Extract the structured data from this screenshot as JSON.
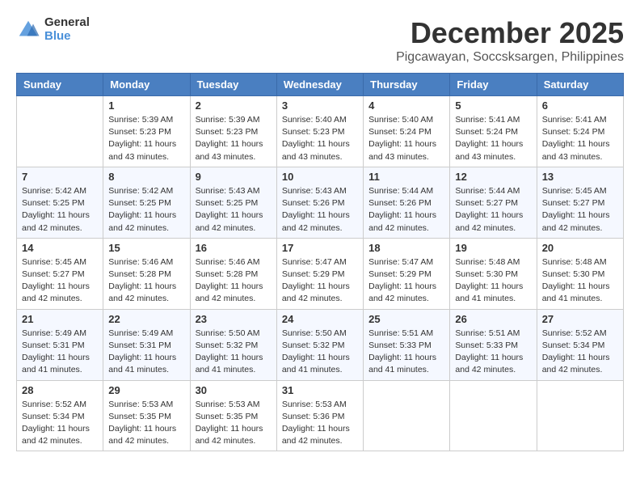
{
  "header": {
    "logo_line1": "General",
    "logo_line2": "Blue",
    "month": "December 2025",
    "location": "Pigcawayan, Soccsksargen, Philippines"
  },
  "weekdays": [
    "Sunday",
    "Monday",
    "Tuesday",
    "Wednesday",
    "Thursday",
    "Friday",
    "Saturday"
  ],
  "weeks": [
    [
      {
        "day": "",
        "info": ""
      },
      {
        "day": "1",
        "info": "Sunrise: 5:39 AM\nSunset: 5:23 PM\nDaylight: 11 hours\nand 43 minutes."
      },
      {
        "day": "2",
        "info": "Sunrise: 5:39 AM\nSunset: 5:23 PM\nDaylight: 11 hours\nand 43 minutes."
      },
      {
        "day": "3",
        "info": "Sunrise: 5:40 AM\nSunset: 5:23 PM\nDaylight: 11 hours\nand 43 minutes."
      },
      {
        "day": "4",
        "info": "Sunrise: 5:40 AM\nSunset: 5:24 PM\nDaylight: 11 hours\nand 43 minutes."
      },
      {
        "day": "5",
        "info": "Sunrise: 5:41 AM\nSunset: 5:24 PM\nDaylight: 11 hours\nand 43 minutes."
      },
      {
        "day": "6",
        "info": "Sunrise: 5:41 AM\nSunset: 5:24 PM\nDaylight: 11 hours\nand 43 minutes."
      }
    ],
    [
      {
        "day": "7",
        "info": "Sunrise: 5:42 AM\nSunset: 5:25 PM\nDaylight: 11 hours\nand 42 minutes."
      },
      {
        "day": "8",
        "info": "Sunrise: 5:42 AM\nSunset: 5:25 PM\nDaylight: 11 hours\nand 42 minutes."
      },
      {
        "day": "9",
        "info": "Sunrise: 5:43 AM\nSunset: 5:25 PM\nDaylight: 11 hours\nand 42 minutes."
      },
      {
        "day": "10",
        "info": "Sunrise: 5:43 AM\nSunset: 5:26 PM\nDaylight: 11 hours\nand 42 minutes."
      },
      {
        "day": "11",
        "info": "Sunrise: 5:44 AM\nSunset: 5:26 PM\nDaylight: 11 hours\nand 42 minutes."
      },
      {
        "day": "12",
        "info": "Sunrise: 5:44 AM\nSunset: 5:27 PM\nDaylight: 11 hours\nand 42 minutes."
      },
      {
        "day": "13",
        "info": "Sunrise: 5:45 AM\nSunset: 5:27 PM\nDaylight: 11 hours\nand 42 minutes."
      }
    ],
    [
      {
        "day": "14",
        "info": "Sunrise: 5:45 AM\nSunset: 5:27 PM\nDaylight: 11 hours\nand 42 minutes."
      },
      {
        "day": "15",
        "info": "Sunrise: 5:46 AM\nSunset: 5:28 PM\nDaylight: 11 hours\nand 42 minutes."
      },
      {
        "day": "16",
        "info": "Sunrise: 5:46 AM\nSunset: 5:28 PM\nDaylight: 11 hours\nand 42 minutes."
      },
      {
        "day": "17",
        "info": "Sunrise: 5:47 AM\nSunset: 5:29 PM\nDaylight: 11 hours\nand 42 minutes."
      },
      {
        "day": "18",
        "info": "Sunrise: 5:47 AM\nSunset: 5:29 PM\nDaylight: 11 hours\nand 42 minutes."
      },
      {
        "day": "19",
        "info": "Sunrise: 5:48 AM\nSunset: 5:30 PM\nDaylight: 11 hours\nand 41 minutes."
      },
      {
        "day": "20",
        "info": "Sunrise: 5:48 AM\nSunset: 5:30 PM\nDaylight: 11 hours\nand 41 minutes."
      }
    ],
    [
      {
        "day": "21",
        "info": "Sunrise: 5:49 AM\nSunset: 5:31 PM\nDaylight: 11 hours\nand 41 minutes."
      },
      {
        "day": "22",
        "info": "Sunrise: 5:49 AM\nSunset: 5:31 PM\nDaylight: 11 hours\nand 41 minutes."
      },
      {
        "day": "23",
        "info": "Sunrise: 5:50 AM\nSunset: 5:32 PM\nDaylight: 11 hours\nand 41 minutes."
      },
      {
        "day": "24",
        "info": "Sunrise: 5:50 AM\nSunset: 5:32 PM\nDaylight: 11 hours\nand 41 minutes."
      },
      {
        "day": "25",
        "info": "Sunrise: 5:51 AM\nSunset: 5:33 PM\nDaylight: 11 hours\nand 41 minutes."
      },
      {
        "day": "26",
        "info": "Sunrise: 5:51 AM\nSunset: 5:33 PM\nDaylight: 11 hours\nand 42 minutes."
      },
      {
        "day": "27",
        "info": "Sunrise: 5:52 AM\nSunset: 5:34 PM\nDaylight: 11 hours\nand 42 minutes."
      }
    ],
    [
      {
        "day": "28",
        "info": "Sunrise: 5:52 AM\nSunset: 5:34 PM\nDaylight: 11 hours\nand 42 minutes."
      },
      {
        "day": "29",
        "info": "Sunrise: 5:53 AM\nSunset: 5:35 PM\nDaylight: 11 hours\nand 42 minutes."
      },
      {
        "day": "30",
        "info": "Sunrise: 5:53 AM\nSunset: 5:35 PM\nDaylight: 11 hours\nand 42 minutes."
      },
      {
        "day": "31",
        "info": "Sunrise: 5:53 AM\nSunset: 5:36 PM\nDaylight: 11 hours\nand 42 minutes."
      },
      {
        "day": "",
        "info": ""
      },
      {
        "day": "",
        "info": ""
      },
      {
        "day": "",
        "info": ""
      }
    ]
  ]
}
